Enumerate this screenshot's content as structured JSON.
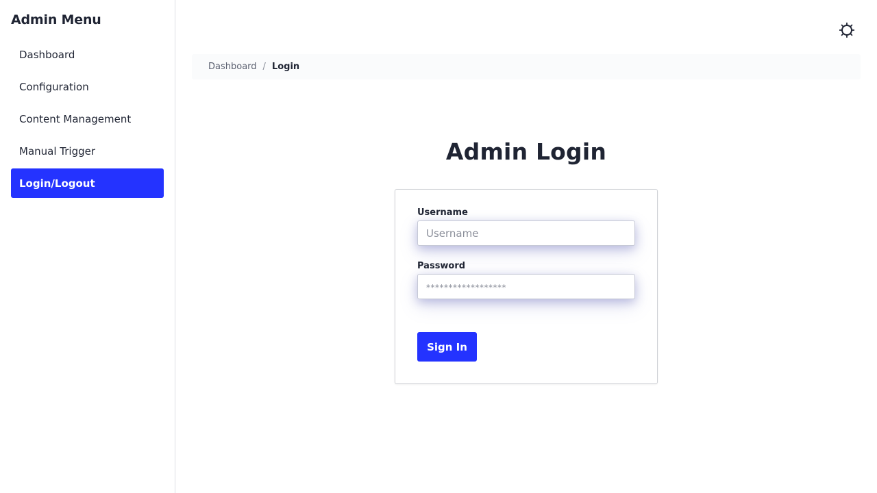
{
  "sidebar": {
    "title": "Admin Menu",
    "items": [
      {
        "label": "Dashboard",
        "active": false
      },
      {
        "label": "Configuration",
        "active": false
      },
      {
        "label": "Content Management",
        "active": false
      },
      {
        "label": "Manual Trigger",
        "active": false
      },
      {
        "label": "Login/Logout",
        "active": true
      }
    ]
  },
  "header": {
    "theme_toggle_icon": "sun-icon"
  },
  "breadcrumb": {
    "items": [
      {
        "label": "Dashboard",
        "current": false
      },
      {
        "label": "Login",
        "current": true
      }
    ],
    "separator": "/"
  },
  "main": {
    "title": "Admin Login",
    "form": {
      "username_label": "Username",
      "username_placeholder": "Username",
      "username_value": "",
      "password_label": "Password",
      "password_placeholder": "******************",
      "password_value": "",
      "submit_label": "Sign In"
    }
  },
  "colors": {
    "accent": "#2433ff",
    "text": "#1f2433",
    "border": "#dcdde2"
  }
}
